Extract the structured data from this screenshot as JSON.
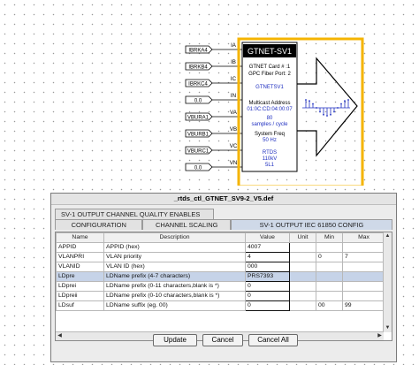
{
  "schematic": {
    "input_labels": [
      "IBRKA4",
      "IBRKB4",
      "IBRKC4",
      "0.0",
      "VBURA1",
      "VBURB1",
      "VBURC1",
      "0.0"
    ],
    "pin_labels": [
      "IA",
      "IB",
      "IC",
      "IN",
      "VA",
      "VB",
      "VC",
      "VN"
    ],
    "block_title": "GTNET-SV1",
    "lines": [
      {
        "text": "GTNET Card # :1",
        "color": "#000000"
      },
      {
        "text": "GPC Fiber Port: 2",
        "color": "#000000"
      },
      {
        "text": "GTNETSV1",
        "color": "#1f2fc0"
      },
      {
        "text": "Multicast Address",
        "color": "#000000"
      },
      {
        "text": "01:0C:CD:04:00:07",
        "color": "#1f2fc0"
      },
      {
        "text": "80",
        "color": "#1f2fc0"
      },
      {
        "text": "samples / cycle",
        "color": "#1f2fc0"
      },
      {
        "text": "System Freq",
        "color": "#000000"
      },
      {
        "text": "50 Hz",
        "color": "#1f2fc0"
      },
      {
        "text": "RTDS",
        "color": "#1f2fc0"
      },
      {
        "text": "110kV",
        "color": "#1f2fc0"
      },
      {
        "text": "5L1",
        "color": "#1f2fc0"
      }
    ],
    "highlight_color": "#f5b400"
  },
  "dialog": {
    "title": "_rtds_ctl_GTNET_SV9-2_V5.def",
    "tabs_row1": [
      "SV-1 OUTPUT CHANNEL QUALITY ENABLES"
    ],
    "tabs_row2": [
      "CONFIGURATION",
      "CHANNEL SCALING",
      "SV-1 OUTPUT IEC 61850 CONFIG"
    ],
    "columns": [
      "Name",
      "Description",
      "Value",
      "Unit",
      "Min",
      "Max"
    ],
    "rows": [
      {
        "name": "APPID",
        "description": "APPID (hex)",
        "value": "4007",
        "unit": "",
        "min": "",
        "max": ""
      },
      {
        "name": "VLANPRI",
        "description": "VLAN priority",
        "value": "4",
        "unit": "",
        "min": "0",
        "max": "7"
      },
      {
        "name": "VLANID",
        "description": "VLAN ID (hex)",
        "value": "000",
        "unit": "",
        "min": "",
        "max": ""
      },
      {
        "name": "LDpre",
        "description": "LDName prefix (4-7 characters)",
        "value": "PRS7393",
        "unit": "",
        "min": "",
        "max": ""
      },
      {
        "name": "LDprei",
        "description": "LDName prefix (0-11 characters,blank is *)",
        "value": "0",
        "unit": "",
        "min": "",
        "max": ""
      },
      {
        "name": "LDpreii",
        "description": "LDName prefix (0-10 characters,blank is *)",
        "value": "0",
        "unit": "",
        "min": "",
        "max": ""
      },
      {
        "name": "LDsuf",
        "description": "LDName suffix (eg. 00)",
        "value": "0",
        "unit": "",
        "min": "00",
        "max": "99"
      }
    ],
    "buttons": {
      "update": "Update",
      "cancel": "Cancel",
      "cancel_all": "Cancel All"
    }
  }
}
